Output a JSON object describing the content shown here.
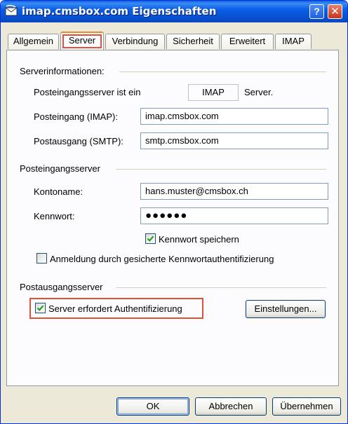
{
  "window": {
    "title": "imap.cmsbox.com Eigenschaften",
    "help_label": "?",
    "close_label": "✕"
  },
  "tabs": [
    {
      "label": "Allgemein",
      "active": false
    },
    {
      "label": "Server",
      "active": true
    },
    {
      "label": "Verbindung",
      "active": false
    },
    {
      "label": "Sicherheit",
      "active": false
    },
    {
      "label": "Erweitert",
      "active": false
    },
    {
      "label": "IMAP",
      "active": false
    }
  ],
  "server_info": {
    "heading": "Serverinformationen:",
    "incoming_type_label": "Posteingangsserver ist ein",
    "incoming_type_value": "IMAP",
    "incoming_type_suffix": "Server.",
    "incoming_label": "Posteingang (IMAP):",
    "incoming_value": "imap.cmsbox.com",
    "outgoing_label": "Postausgang (SMTP):",
    "outgoing_value": "smtp.cmsbox.com"
  },
  "incoming_server": {
    "heading": "Posteingangsserver",
    "account_label": "Kontoname:",
    "account_value": "hans.muster@cmsbox.ch",
    "password_label": "Kennwort:",
    "password_value": "●●●●●●",
    "remember_label": "Kennwort speichern",
    "remember_checked": true,
    "spa_label": "Anmeldung durch gesicherte Kennwortauthentifizierung",
    "spa_checked": false
  },
  "outgoing_server": {
    "heading": "Postausgangsserver",
    "auth_label": "Server erfordert Authentifizierung",
    "auth_checked": true,
    "settings_button": "Einstellungen..."
  },
  "buttons": {
    "ok": "OK",
    "cancel": "Abbrechen",
    "apply": "Übernehmen"
  },
  "colors": {
    "titlebar": "#0a5fe8",
    "dialog_bg": "#ece9d8",
    "highlight": "#e0503a",
    "check": "#21a121"
  }
}
